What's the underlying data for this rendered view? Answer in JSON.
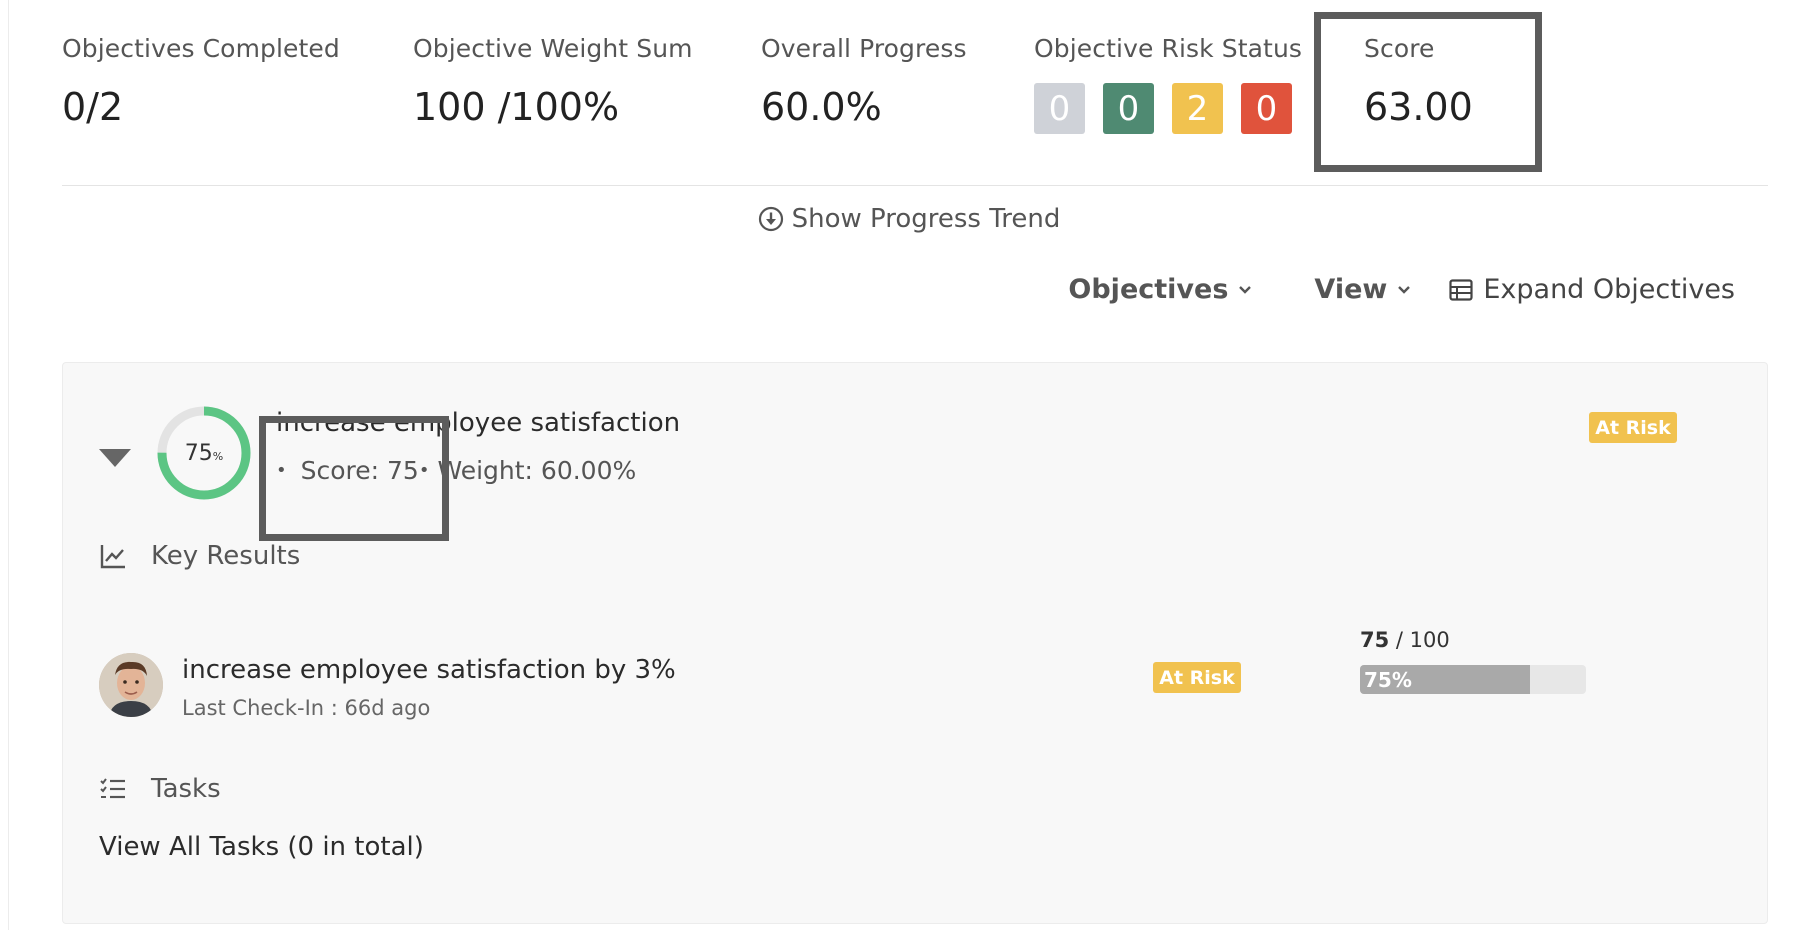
{
  "stats": {
    "completed": {
      "label": "Objectives Completed",
      "value": "0/2"
    },
    "weight": {
      "label": "Objective Weight Sum",
      "value": "100 /100%"
    },
    "progress": {
      "label": "Overall Progress",
      "value": "60.0%"
    },
    "risk": {
      "label": "Objective Risk Status",
      "counts": [
        {
          "value": "0",
          "color": "#cfd2d8"
        },
        {
          "value": "0",
          "color": "#4f8a72"
        },
        {
          "value": "2",
          "color": "#f1c24f"
        },
        {
          "value": "0",
          "color": "#e0533c"
        }
      ]
    },
    "score": {
      "label": "Score",
      "value": "63.00"
    }
  },
  "trend": {
    "label": "Show Progress Trend",
    "icon": "download-circle-icon"
  },
  "controls": {
    "objectives_label": "Objectives",
    "view_label": "View",
    "expand_label": "Expand Objectives",
    "chevron": "⌄"
  },
  "objective": {
    "progress_percent": 75,
    "progress_text": "75",
    "percent_sign": "%",
    "title": "increase employee satisfaction",
    "score_text": "Score: 75",
    "weight_text": "Weight: 60.00%",
    "bullet": "•",
    "status": "At Risk",
    "ring_color": "#5cc584",
    "ring_track": "#e3e3e3"
  },
  "key_results": {
    "heading": "Key Results",
    "items": [
      {
        "title": "increase employee satisfaction by 3%",
        "checkin": "Last Check-In : 66d ago",
        "status": "At Risk",
        "current": "75",
        "target": "/ 100",
        "progress_label": "75%",
        "progress_percent": 75
      }
    ]
  },
  "tasks": {
    "heading": "Tasks",
    "view_all": "View All Tasks (0 in total)"
  }
}
